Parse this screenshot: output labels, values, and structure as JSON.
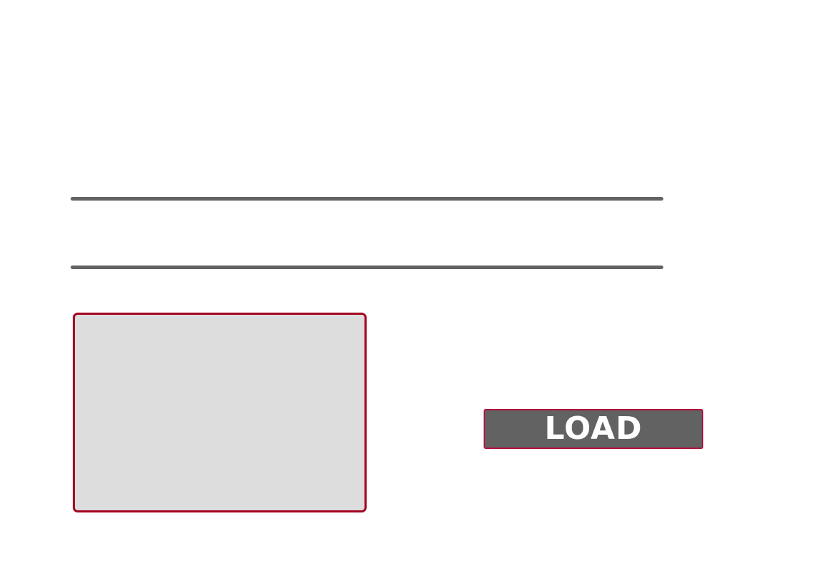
{
  "colors": {
    "rule": "#636363",
    "accent_border": "#a3021f",
    "button_bg": "#626262",
    "button_border": "#b3103e",
    "button_text": "#ffffff",
    "preview_bg": "#dddddd"
  },
  "actions": {
    "load_label": "LOAD"
  }
}
